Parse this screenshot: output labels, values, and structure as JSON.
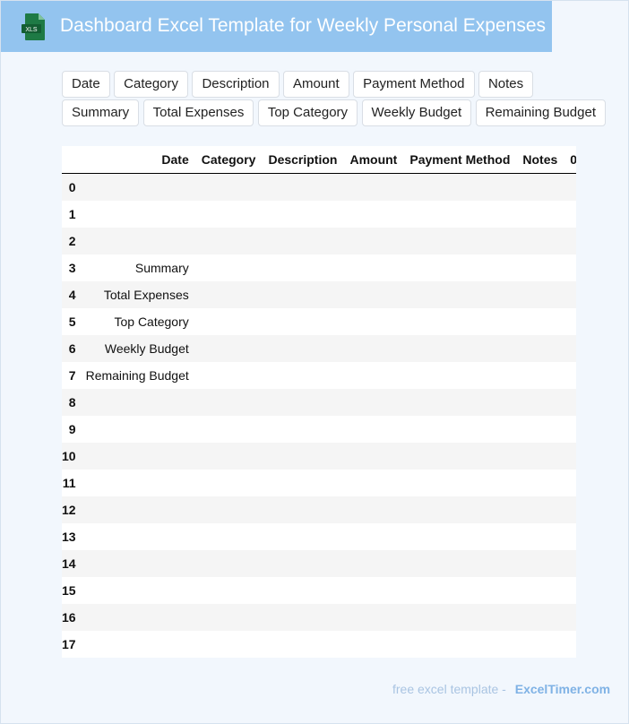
{
  "header": {
    "title": "Dashboard Excel Template for Weekly Personal Expenses",
    "icon_label": "XLS",
    "icon_color": "#1e7a45"
  },
  "tags": [
    "Date",
    "Category",
    "Description",
    "Amount",
    "Payment Method",
    "Notes",
    "Summary",
    "Total Expenses",
    "Top Category",
    "Weekly Budget",
    "Remaining Budget"
  ],
  "table": {
    "columns": [
      "Date",
      "Category",
      "Description",
      "Amount",
      "Payment Method",
      "Notes",
      "0"
    ],
    "rows": [
      {
        "index": "0",
        "date": ""
      },
      {
        "index": "1",
        "date": ""
      },
      {
        "index": "2",
        "date": ""
      },
      {
        "index": "3",
        "date": "Summary"
      },
      {
        "index": "4",
        "date": "Total Expenses"
      },
      {
        "index": "5",
        "date": "Top Category"
      },
      {
        "index": "6",
        "date": "Weekly Budget"
      },
      {
        "index": "7",
        "date": "Remaining Budget"
      },
      {
        "index": "8",
        "date": ""
      },
      {
        "index": "9",
        "date": ""
      },
      {
        "index": "10",
        "date": ""
      },
      {
        "index": "11",
        "date": ""
      },
      {
        "index": "12",
        "date": ""
      },
      {
        "index": "13",
        "date": ""
      },
      {
        "index": "14",
        "date": ""
      },
      {
        "index": "15",
        "date": ""
      },
      {
        "index": "16",
        "date": ""
      },
      {
        "index": "17",
        "date": ""
      }
    ]
  },
  "footer": {
    "text": "free excel template -",
    "brand": "ExcelTimer.com"
  }
}
